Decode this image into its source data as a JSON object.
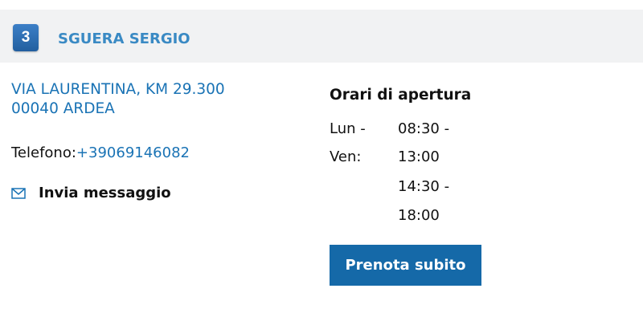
{
  "listing": {
    "number": "3",
    "name": "SGUERA SERGIO",
    "address_line1": "VIA LAURENTINA, KM 29.300",
    "address_line2": "00040 ARDEA",
    "phone_label": "Telefono:",
    "phone_number": "+39069146082",
    "message_label": "Invia messaggio",
    "message_icon": "mail-icon"
  },
  "hours": {
    "title": "Orari di apertura",
    "day_line1": "Lun -",
    "day_line2": "Ven:",
    "times": [
      "08:30 -",
      "13:00",
      "14:30 -",
      "18:00"
    ]
  },
  "actions": {
    "book_label": "Prenota subito"
  },
  "colors": {
    "header_bg": "#f1f2f3",
    "badge": "#2d6fb3",
    "name": "#3a8ac4",
    "link": "#1a73b5",
    "button": "#1569a8"
  }
}
